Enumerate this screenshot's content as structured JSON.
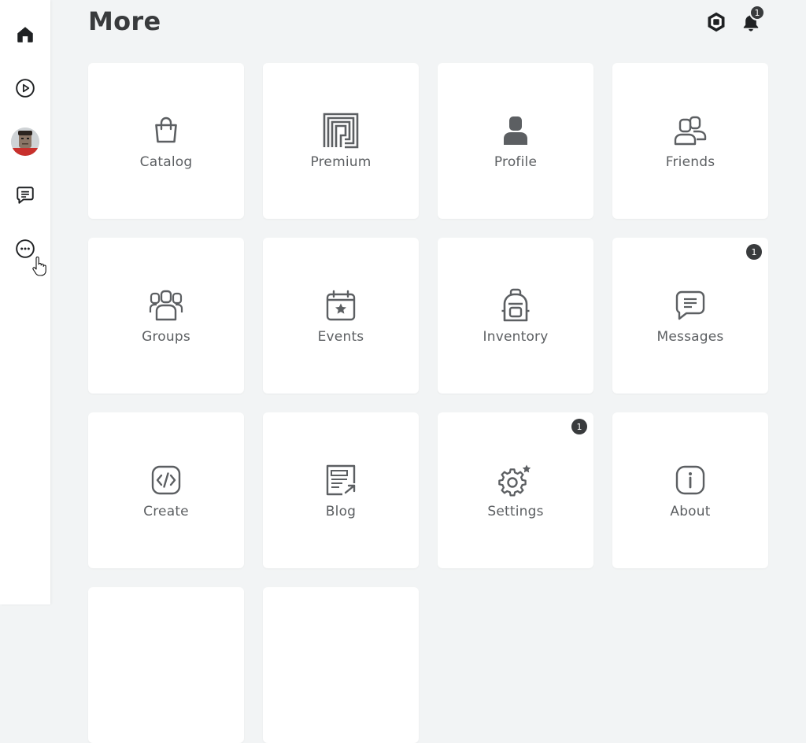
{
  "page": {
    "title": "More"
  },
  "sidebar": {
    "items": [
      {
        "name": "home",
        "icon": "home-icon"
      },
      {
        "name": "discover",
        "icon": "play-circle-icon"
      },
      {
        "name": "avatar",
        "icon": "avatar"
      },
      {
        "name": "chat",
        "icon": "chat-icon"
      },
      {
        "name": "more",
        "icon": "more-icon"
      }
    ]
  },
  "header": {
    "robux_icon": "robux-icon",
    "notifications_icon": "bell-icon",
    "notifications_count": "1"
  },
  "tiles": [
    {
      "label": "Catalog",
      "icon": "shopping-bag-icon",
      "badge": ""
    },
    {
      "label": "Premium",
      "icon": "premium-icon",
      "badge": ""
    },
    {
      "label": "Profile",
      "icon": "profile-icon",
      "badge": ""
    },
    {
      "label": "Friends",
      "icon": "friends-icon",
      "badge": ""
    },
    {
      "label": "Groups",
      "icon": "groups-icon",
      "badge": ""
    },
    {
      "label": "Events",
      "icon": "calendar-star-icon",
      "badge": ""
    },
    {
      "label": "Inventory",
      "icon": "backpack-icon",
      "badge": ""
    },
    {
      "label": "Messages",
      "icon": "message-icon",
      "badge": "1"
    },
    {
      "label": "Create",
      "icon": "code-icon",
      "badge": ""
    },
    {
      "label": "Blog",
      "icon": "blog-icon",
      "badge": ""
    },
    {
      "label": "Settings",
      "icon": "gear-icon",
      "badge": "1"
    },
    {
      "label": "About",
      "icon": "info-icon",
      "badge": ""
    }
  ],
  "colors": {
    "background": "#f2f4f5",
    "tile": "#ffffff",
    "text": "#5c5f62",
    "title": "#393b3d",
    "badge": "#393b3d"
  }
}
